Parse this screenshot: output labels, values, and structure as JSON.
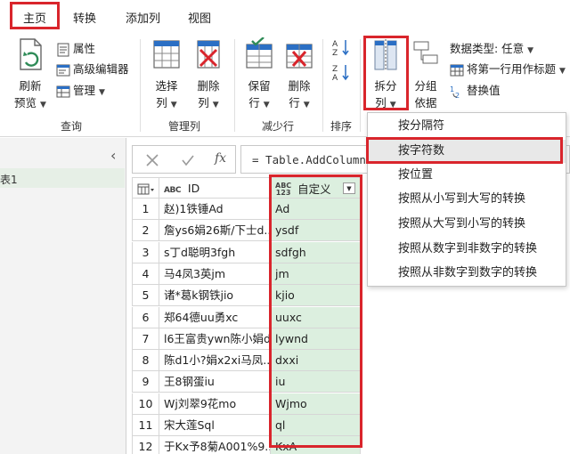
{
  "tabs": [
    {
      "label": "主页",
      "active": true
    },
    {
      "label": "转换"
    },
    {
      "label": "添加列"
    },
    {
      "label": "视图"
    }
  ],
  "ribbon": {
    "query": {
      "label": "查询",
      "refresh_line1": "刷新",
      "refresh_line2": "预览",
      "properties": "属性",
      "advanced_editor": "高级编辑器",
      "manage": "管理"
    },
    "manage_columns": {
      "label": "管理列",
      "choose_line1": "选择",
      "choose_line2": "列",
      "remove_line1": "删除",
      "remove_line2": "列"
    },
    "reduce_rows": {
      "label": "减少行",
      "keep_line1": "保留",
      "keep_line2": "行",
      "remove_line1": "删除",
      "remove_line2": "行"
    },
    "sort": {
      "label": "排序"
    },
    "transform": {
      "split_line1": "拆分",
      "split_line2": "列",
      "group_line1": "分组",
      "group_line2": "依据",
      "data_type_label": "数据类型: 任意",
      "first_row_header": "将第一行用作标题",
      "replace_values": "替换值"
    }
  },
  "split_menu": {
    "items": [
      {
        "label": "按分隔符"
      },
      {
        "label": "按字符数",
        "active": true
      },
      {
        "label": "按位置"
      },
      {
        "label": "按照从小写到大写的转换"
      },
      {
        "label": "按照从大写到小写的转换"
      },
      {
        "label": "按照从数字到非数字的转换"
      },
      {
        "label": "按照从非数字到数字的转换"
      }
    ]
  },
  "left_panel": {
    "query_name": "表1"
  },
  "formula_bar": {
    "fx_symbol": "fx",
    "formula": "= Table.AddColumn("
  },
  "grid": {
    "columns": [
      {
        "type_badge": "ABC",
        "type_badge_sub": "",
        "name": "ID"
      },
      {
        "type_badge": "ABC",
        "type_badge_sub": "123",
        "name": "自定义"
      }
    ],
    "rows": [
      {
        "num": "1",
        "id": "赵)1铁锤Ad",
        "custom": "Ad"
      },
      {
        "num": "2",
        "id": "詹ys6娟26斯/下士d...",
        "custom": "ysdf"
      },
      {
        "num": "3",
        "id": "s丁d聪明3fgh",
        "custom": "sdfgh"
      },
      {
        "num": "4",
        "id": "马4凤3英jm",
        "custom": "jm"
      },
      {
        "num": "5",
        "id": "诸*葛k钢铁jio",
        "custom": "kjio"
      },
      {
        "num": "6",
        "id": "郑64德uu勇xc",
        "custom": "uuxc"
      },
      {
        "num": "7",
        "id": "l6王富贵ywn陈小娟d",
        "custom": "lywnd"
      },
      {
        "num": "8",
        "id": "陈d1小?娟x2xi马凤...",
        "custom": "dxxi"
      },
      {
        "num": "9",
        "id": "王8钢蛋iu",
        "custom": "iu"
      },
      {
        "num": "10",
        "id": "Wj刘翠9花mo",
        "custom": "Wjmo"
      },
      {
        "num": "11",
        "id": "宋大莲Sql",
        "custom": "ql"
      },
      {
        "num": "12",
        "id": "于Kx予8菊A001%9...",
        "custom": "KxA"
      }
    ]
  },
  "colors": {
    "highlight_red": "#d9252c",
    "custom_column_bg": "#dcefdf",
    "accent_blue": "#2b6fc4",
    "accent_green": "#2e8b57"
  }
}
